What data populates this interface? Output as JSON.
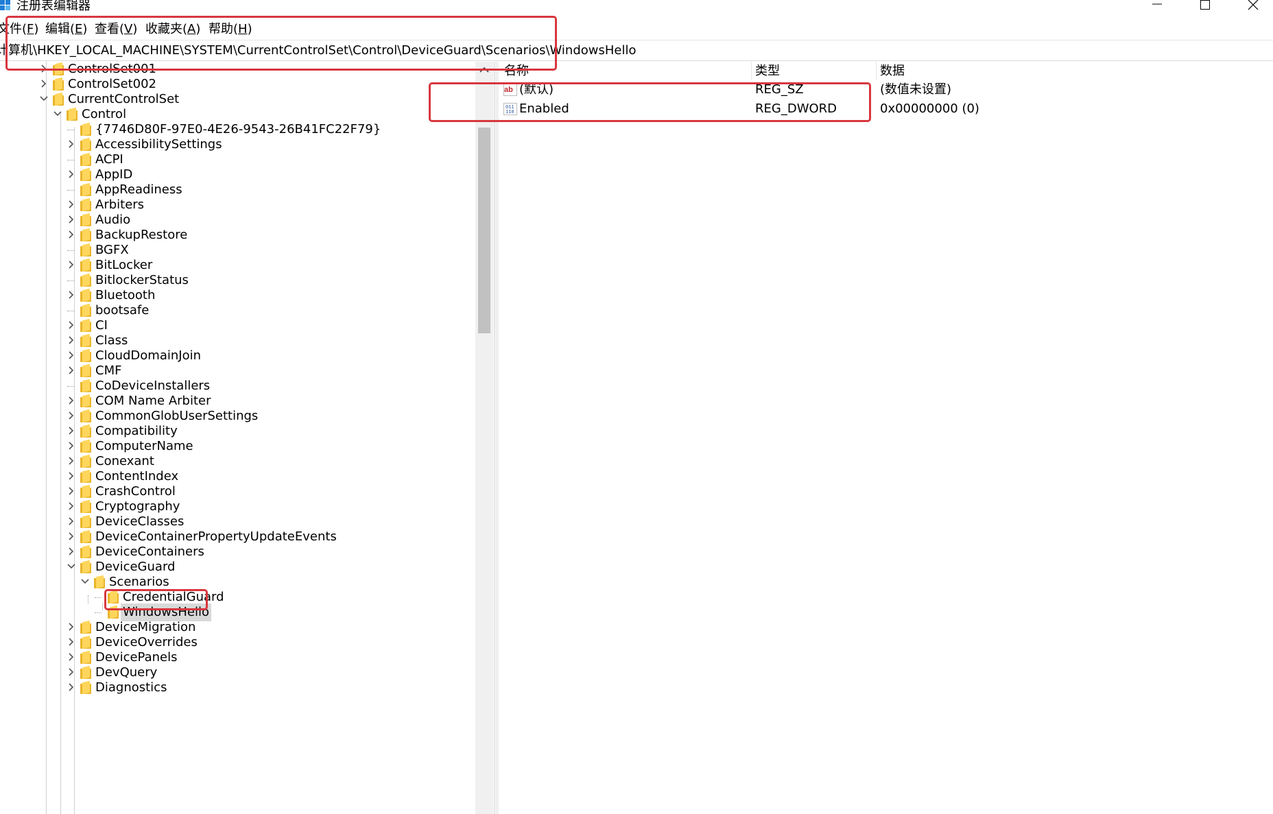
{
  "window": {
    "title": "注册表编辑器",
    "controls": [
      "minimize-icon",
      "maximize-icon",
      "close-icon"
    ]
  },
  "menu": [
    {
      "label": "文件(",
      "key": "F",
      "tail": ")"
    },
    {
      "label": "编辑(",
      "key": "E",
      "tail": ")"
    },
    {
      "label": "查看(",
      "key": "V",
      "tail": ")"
    },
    {
      "label": "收藏夹(",
      "key": "A",
      "tail": ")"
    },
    {
      "label": "帮助(",
      "key": "H",
      "tail": ")"
    }
  ],
  "address": "计算机\\HKEY_LOCAL_MACHINE\\SYSTEM\\CurrentControlSet\\Control\\DeviceGuard\\Scenarios\\WindowsHello",
  "tree": [
    {
      "label": "ControlSet001",
      "level": 0,
      "state": "collapsed"
    },
    {
      "label": "ControlSet002",
      "level": 0,
      "state": "collapsed"
    },
    {
      "label": "CurrentControlSet",
      "level": 0,
      "state": "expanded"
    },
    {
      "label": "Control",
      "level": 1,
      "state": "expanded"
    },
    {
      "label": "{7746D80F-97E0-4E26-9543-26B41FC22F79}",
      "level": 2,
      "state": "leaf"
    },
    {
      "label": "AccessibilitySettings",
      "level": 2,
      "state": "collapsed"
    },
    {
      "label": "ACPI",
      "level": 2,
      "state": "leaf"
    },
    {
      "label": "AppID",
      "level": 2,
      "state": "collapsed"
    },
    {
      "label": "AppReadiness",
      "level": 2,
      "state": "leaf"
    },
    {
      "label": "Arbiters",
      "level": 2,
      "state": "collapsed"
    },
    {
      "label": "Audio",
      "level": 2,
      "state": "collapsed"
    },
    {
      "label": "BackupRestore",
      "level": 2,
      "state": "collapsed"
    },
    {
      "label": "BGFX",
      "level": 2,
      "state": "leaf"
    },
    {
      "label": "BitLocker",
      "level": 2,
      "state": "collapsed"
    },
    {
      "label": "BitlockerStatus",
      "level": 2,
      "state": "leaf"
    },
    {
      "label": "Bluetooth",
      "level": 2,
      "state": "collapsed"
    },
    {
      "label": "bootsafe",
      "level": 2,
      "state": "leaf"
    },
    {
      "label": "CI",
      "level": 2,
      "state": "collapsed"
    },
    {
      "label": "Class",
      "level": 2,
      "state": "collapsed"
    },
    {
      "label": "CloudDomainJoin",
      "level": 2,
      "state": "collapsed"
    },
    {
      "label": "CMF",
      "level": 2,
      "state": "collapsed"
    },
    {
      "label": "CoDeviceInstallers",
      "level": 2,
      "state": "leaf"
    },
    {
      "label": "COM Name Arbiter",
      "level": 2,
      "state": "collapsed"
    },
    {
      "label": "CommonGlobUserSettings",
      "level": 2,
      "state": "collapsed"
    },
    {
      "label": "Compatibility",
      "level": 2,
      "state": "collapsed"
    },
    {
      "label": "ComputerName",
      "level": 2,
      "state": "collapsed"
    },
    {
      "label": "Conexant",
      "level": 2,
      "state": "collapsed"
    },
    {
      "label": "ContentIndex",
      "level": 2,
      "state": "collapsed"
    },
    {
      "label": "CrashControl",
      "level": 2,
      "state": "collapsed"
    },
    {
      "label": "Cryptography",
      "level": 2,
      "state": "collapsed"
    },
    {
      "label": "DeviceClasses",
      "level": 2,
      "state": "collapsed"
    },
    {
      "label": "DeviceContainerPropertyUpdateEvents",
      "level": 2,
      "state": "collapsed"
    },
    {
      "label": "DeviceContainers",
      "level": 2,
      "state": "collapsed"
    },
    {
      "label": "DeviceGuard",
      "level": 2,
      "state": "expanded"
    },
    {
      "label": "Scenarios",
      "level": 3,
      "state": "expanded"
    },
    {
      "label": "CredentialGuard",
      "level": 4,
      "state": "leaf"
    },
    {
      "label": "WindowsHello",
      "level": 4,
      "state": "leaf",
      "selected": true
    },
    {
      "label": "DeviceMigration",
      "level": 2,
      "state": "collapsed"
    },
    {
      "label": "DeviceOverrides",
      "level": 2,
      "state": "collapsed"
    },
    {
      "label": "DevicePanels",
      "level": 2,
      "state": "collapsed"
    },
    {
      "label": "DevQuery",
      "level": 2,
      "state": "collapsed"
    },
    {
      "label": "Diagnostics",
      "level": 2,
      "state": "collapsed"
    }
  ],
  "columns": {
    "name": "名称",
    "type": "类型",
    "data": "数据"
  },
  "values": [
    {
      "icon": "string-value-icon",
      "name": "(默认)",
      "type": "REG_SZ",
      "data": "(数值未设置)"
    },
    {
      "icon": "binary-value-icon",
      "name": "Enabled",
      "type": "REG_DWORD",
      "data": "0x00000000 (0)"
    }
  ],
  "colors": {
    "highlight": "#d9363e",
    "folder": "#ffd65c",
    "selection": "#d9d9d9"
  }
}
